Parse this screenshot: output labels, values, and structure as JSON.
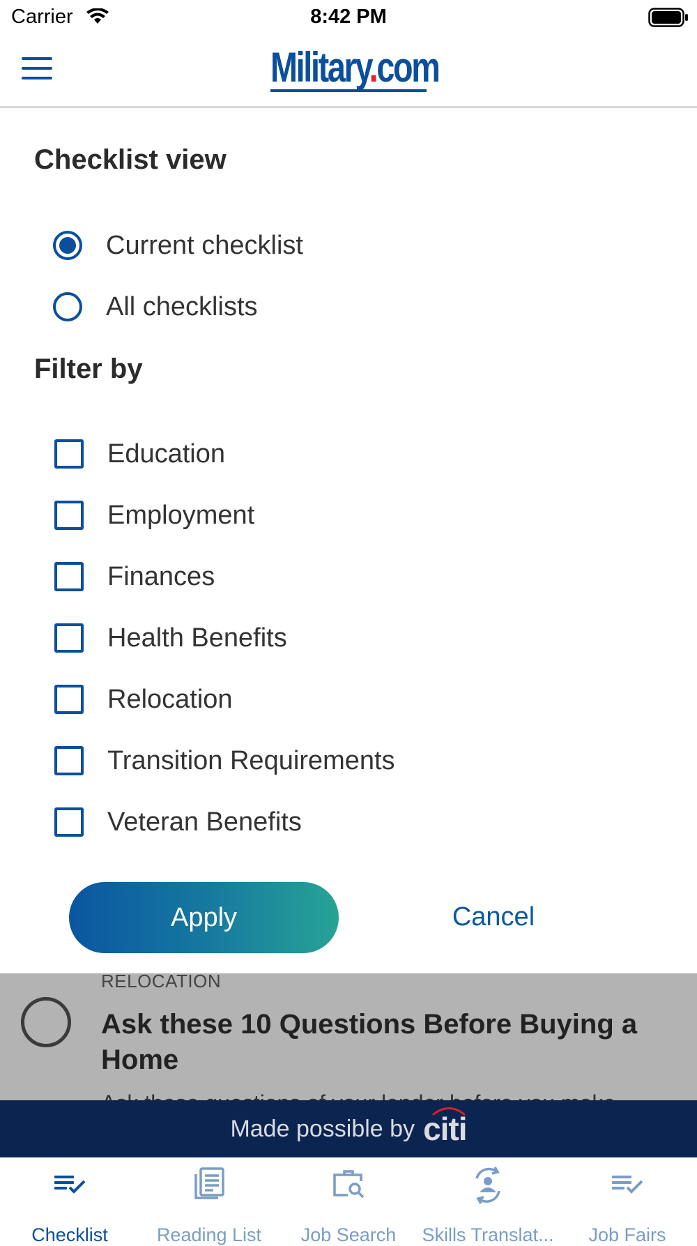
{
  "status_bar": {
    "carrier": "Carrier",
    "time": "8:42 PM"
  },
  "header": {
    "logo_text": "Military",
    "logo_dot": ".",
    "logo_suffix": "com"
  },
  "checklist_view": {
    "title": "Checklist view",
    "options": [
      {
        "label": "Current checklist",
        "selected": true
      },
      {
        "label": "All checklists",
        "selected": false
      }
    ]
  },
  "filter": {
    "title": "Filter by",
    "options": [
      {
        "label": "Education",
        "checked": false
      },
      {
        "label": "Employment",
        "checked": false
      },
      {
        "label": "Finances",
        "checked": false
      },
      {
        "label": "Health Benefits",
        "checked": false
      },
      {
        "label": "Relocation",
        "checked": false
      },
      {
        "label": "Transition Requirements",
        "checked": false
      },
      {
        "label": "Veteran Benefits",
        "checked": false
      }
    ]
  },
  "actions": {
    "apply": "Apply",
    "cancel": "Cancel"
  },
  "background_item": {
    "category": "RELOCATION",
    "title": "Ask these 10 Questions Before Buying a Home",
    "desc": "Ask these questions of your lender before you make"
  },
  "sponsor": {
    "text": "Made possible by",
    "brand": "citi"
  },
  "tabs": [
    {
      "label": "Checklist",
      "icon": "checklist-icon",
      "active": true
    },
    {
      "label": "Reading List",
      "icon": "reading-list-icon",
      "active": false
    },
    {
      "label": "Job Search",
      "icon": "job-search-icon",
      "active": false
    },
    {
      "label": "Skills Translat...",
      "icon": "skills-translator-icon",
      "active": false
    },
    {
      "label": "Job Fairs",
      "icon": "job-fairs-icon",
      "active": false
    }
  ],
  "colors": {
    "primary": "#0b4f9c",
    "tab_inactive": "#7a9dc4",
    "sponsor_bg": "#0c2450",
    "overlay": "#b3b3b3"
  }
}
